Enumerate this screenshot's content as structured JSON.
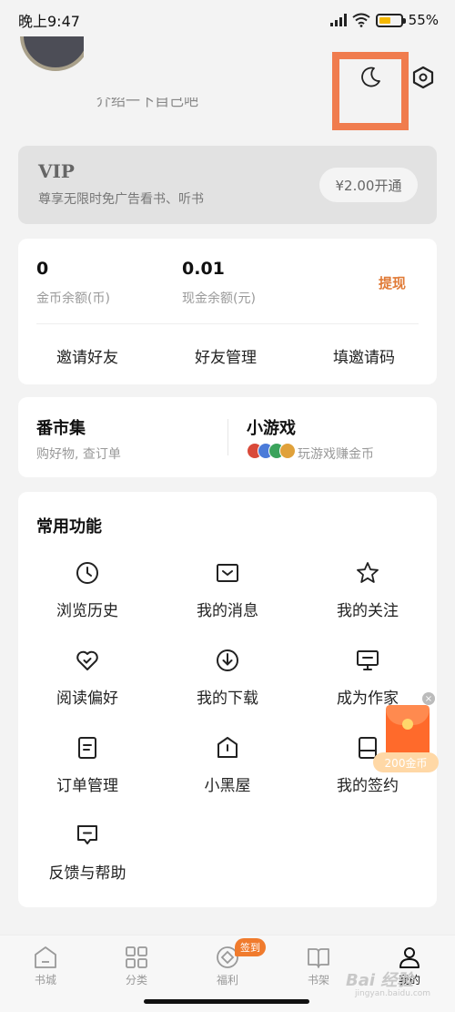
{
  "status_bar": {
    "time": "晚上9:47",
    "battery": "55%",
    "battery_level": 0.55
  },
  "profile": {
    "intro": "介绍一下自己吧"
  },
  "vip": {
    "title": "VIP",
    "description": "尊享无限时免广告看书、听书",
    "button": "¥2.00开通"
  },
  "wallet": {
    "coins_value": "0",
    "coins_label": "金币余额(币)",
    "cash_value": "0.01",
    "cash_label": "现金余额(元)",
    "withdraw": "提现",
    "actions": [
      "邀请好友",
      "好友管理",
      "填邀请码"
    ]
  },
  "market": {
    "left_title": "番市集",
    "left_sub": "购好物, 查订单",
    "right_title": "小游戏",
    "right_sub": "玩游戏赚金币"
  },
  "functions": {
    "title": "常用功能",
    "items": [
      {
        "label": "浏览历史",
        "icon": "clock-icon"
      },
      {
        "label": "我的消息",
        "icon": "message-box-icon"
      },
      {
        "label": "我的关注",
        "icon": "star-icon"
      },
      {
        "label": "阅读偏好",
        "icon": "heart-check-icon"
      },
      {
        "label": "我的下载",
        "icon": "download-icon"
      },
      {
        "label": "成为作家",
        "icon": "monitor-icon"
      },
      {
        "label": "订单管理",
        "icon": "order-doc-icon"
      },
      {
        "label": "小黑屋",
        "icon": "house-icon"
      },
      {
        "label": "我的签约",
        "icon": "contract-icon"
      },
      {
        "label": "反馈与帮助",
        "icon": "feedback-icon"
      }
    ]
  },
  "red_packet": {
    "label": "200金币",
    "close": "×"
  },
  "tabbar": {
    "tabs": [
      {
        "label": "书城",
        "icon": "home-icon"
      },
      {
        "label": "分类",
        "icon": "grid-icon"
      },
      {
        "label": "福利",
        "icon": "welfare-icon"
      },
      {
        "label": "书架",
        "icon": "book-icon"
      },
      {
        "label": "我的",
        "icon": "user-icon"
      }
    ],
    "sign_badge": "签到"
  },
  "watermark": {
    "brand": "Bai 经验",
    "url": "jingyan.baidu.com"
  },
  "colors": {
    "accent": "#e07a36",
    "highlight_box": "#f07c4e",
    "background": "#f3f3f3"
  }
}
